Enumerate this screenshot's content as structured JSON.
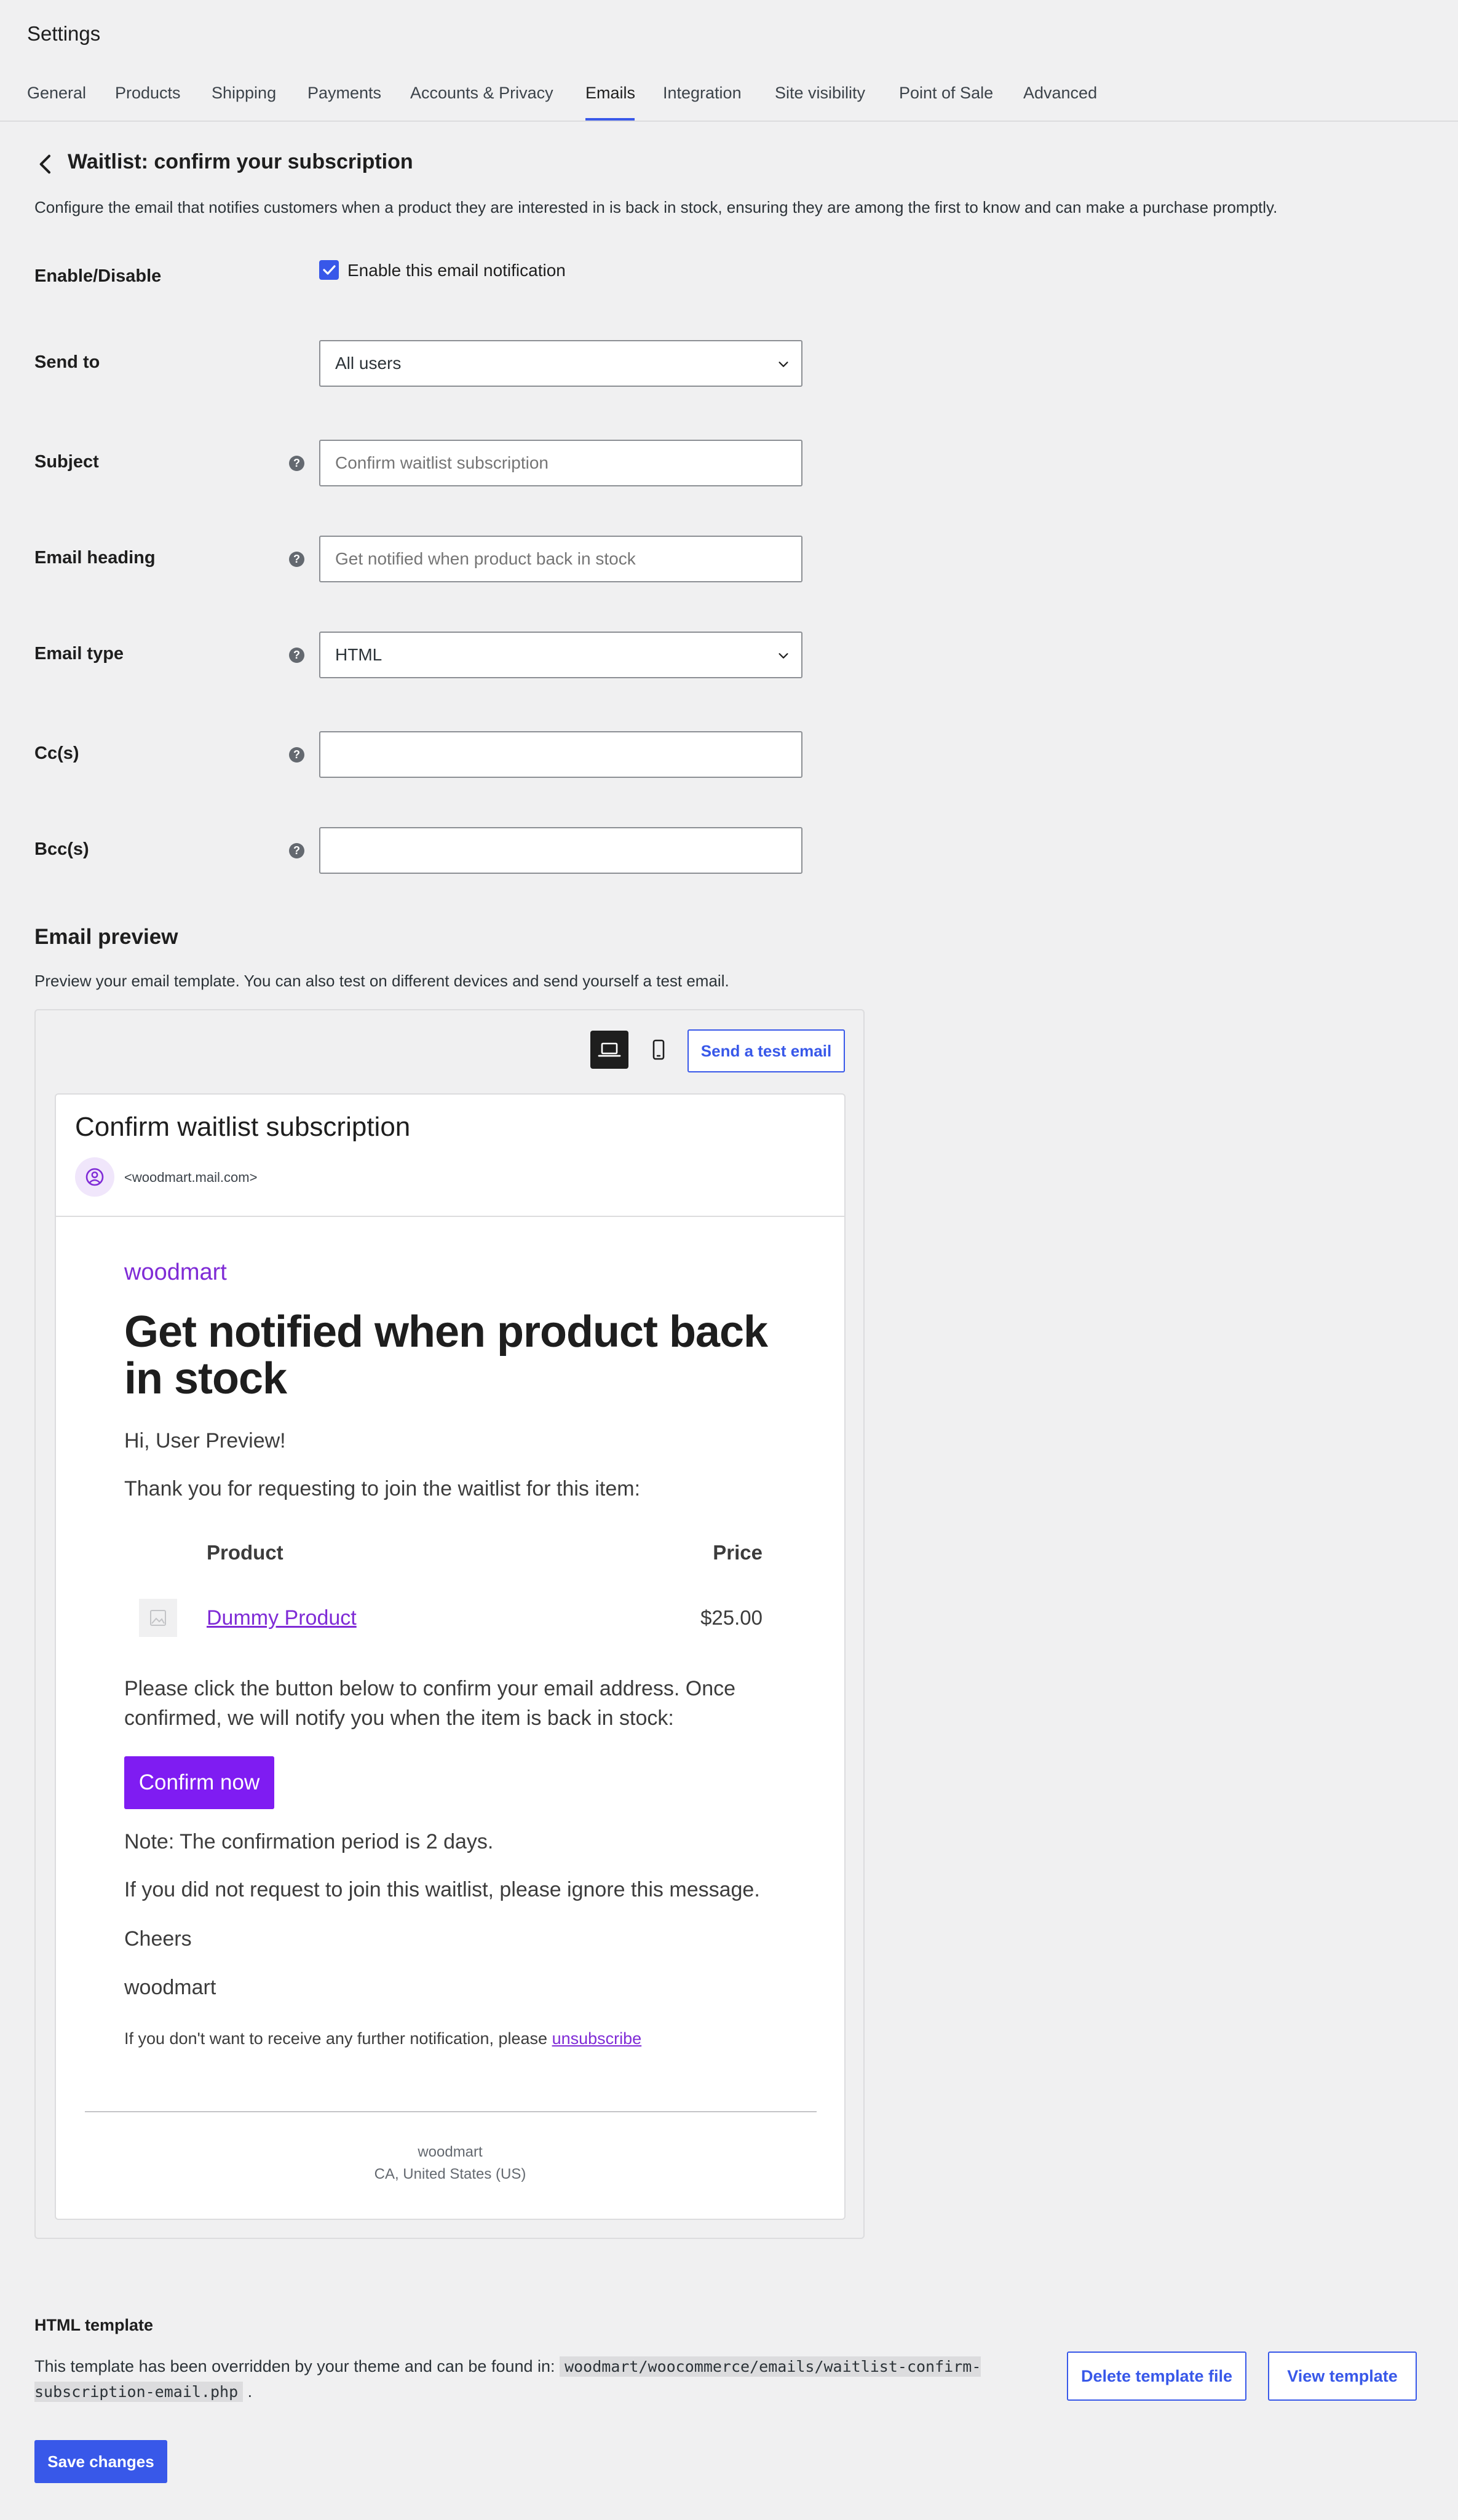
{
  "app": {
    "title": "Settings"
  },
  "tabs": [
    {
      "label": "General"
    },
    {
      "label": "Products"
    },
    {
      "label": "Shipping"
    },
    {
      "label": "Payments"
    },
    {
      "label": "Accounts & Privacy"
    },
    {
      "label": "Emails",
      "active": true
    },
    {
      "label": "Integration"
    },
    {
      "label": "Site visibility"
    },
    {
      "label": "Point of Sale"
    },
    {
      "label": "Advanced"
    }
  ],
  "page": {
    "heading": "Waitlist: confirm your subscription",
    "description": "Configure the email that notifies customers when a product they are interested in is back in stock, ensuring they are among the first to know and can make a purchase promptly."
  },
  "form": {
    "enable": {
      "label": "Enable/Disable",
      "checkbox_label": "Enable this email notification",
      "checked": true
    },
    "send_to": {
      "label": "Send to",
      "value": "All users"
    },
    "subject": {
      "label": "Subject",
      "placeholder": "Confirm waitlist subscription",
      "value": ""
    },
    "heading": {
      "label": "Email heading",
      "placeholder": "Get notified when product back in stock",
      "value": ""
    },
    "email_type": {
      "label": "Email type",
      "value": "HTML"
    },
    "cc": {
      "label": "Cc(s)",
      "value": ""
    },
    "bcc": {
      "label": "Bcc(s)",
      "value": ""
    }
  },
  "preview": {
    "title": "Email preview",
    "description": "Preview your email template. You can also test on different devices and send yourself a test email.",
    "test_button": "Send a test email",
    "device_selected": "laptop",
    "email": {
      "subject": "Confirm waitlist subscription",
      "sender": "<woodmart.mail.com>",
      "brand": "woodmart",
      "title": "Get notified when product back in stock",
      "greeting": "Hi, User Preview!",
      "intro": "Thank you for requesting to join the waitlist for this item:",
      "table": {
        "col_product": "Product",
        "col_price": "Price",
        "product_name": "Dummy Product",
        "product_price": "$25.00"
      },
      "instruction": "Please click the button below to confirm your email address. Once confirmed, we will notify you when the item is back in stock:",
      "confirm_button": "Confirm now",
      "note": "Note: The confirmation period is 2 days.",
      "ignore": "If you did not request to join this waitlist, please ignore this message.",
      "signoff": "Cheers",
      "signature": "woodmart",
      "unsubscribe_text": "If you don't want to receive any further notification, please",
      "unsubscribe_link": "unsubscribe",
      "footer_brand": "woodmart",
      "footer_address": "CA, United States (US)"
    }
  },
  "template": {
    "title": "HTML template",
    "text": "This template has been overridden by your theme and can be found in:",
    "path": "woodmart/woocommerce/emails/waitlist-confirm-subscription-email.php",
    "suffix": ".",
    "delete_button": "Delete template file",
    "view_button": "View template"
  },
  "save_button": "Save changes",
  "colors": {
    "accent": "#3858e9",
    "brand_purple": "#7f2bd6",
    "confirm_button": "#7f1cf2",
    "background": "#f0f0f1"
  }
}
